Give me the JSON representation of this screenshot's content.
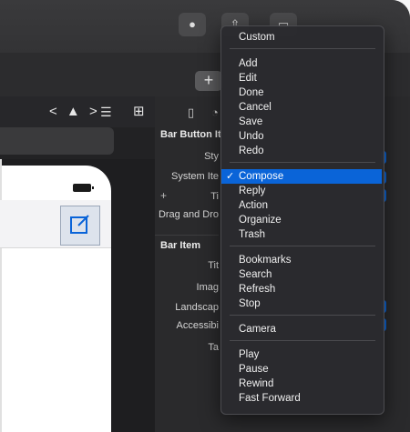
{
  "toolbar": {
    "add_label": "+"
  },
  "editor": {
    "icons": "< ▲ >"
  },
  "inspector": {
    "section_bar_button_item": "Bar Button It",
    "style_label": "Sty",
    "system_item_label": "System Ite",
    "title_label": "Ti",
    "drag_drop_label": "Drag and Dro",
    "section_bar_item": "Bar Item",
    "title2_label": "Tit",
    "image_label": "Imag",
    "landscape_label": "Landscap",
    "accessibility_label": "Accessibi",
    "tag_label": "Ta",
    "plus": "+"
  },
  "menu": {
    "items": [
      {
        "label": "Custom",
        "selected": false
      },
      {
        "label": "Add",
        "selected": false
      },
      {
        "label": "Edit",
        "selected": false
      },
      {
        "label": "Done",
        "selected": false
      },
      {
        "label": "Cancel",
        "selected": false
      },
      {
        "label": "Save",
        "selected": false
      },
      {
        "label": "Undo",
        "selected": false
      },
      {
        "label": "Redo",
        "selected": false
      },
      {
        "label": "Compose",
        "selected": true
      },
      {
        "label": "Reply",
        "selected": false
      },
      {
        "label": "Action",
        "selected": false
      },
      {
        "label": "Organize",
        "selected": false
      },
      {
        "label": "Trash",
        "selected": false
      },
      {
        "label": "Bookmarks",
        "selected": false
      },
      {
        "label": "Search",
        "selected": false
      },
      {
        "label": "Refresh",
        "selected": false
      },
      {
        "label": "Stop",
        "selected": false
      },
      {
        "label": "Camera",
        "selected": false
      },
      {
        "label": "Play",
        "selected": false
      },
      {
        "label": "Pause",
        "selected": false
      },
      {
        "label": "Rewind",
        "selected": false
      },
      {
        "label": "Fast Forward",
        "selected": false
      }
    ],
    "check_mark": "✓",
    "accent_color": "#0a64d8"
  },
  "icons": {
    "compose": "compose-icon",
    "battery": "battery-icon",
    "library": "library-icon",
    "document": "document-icon"
  }
}
